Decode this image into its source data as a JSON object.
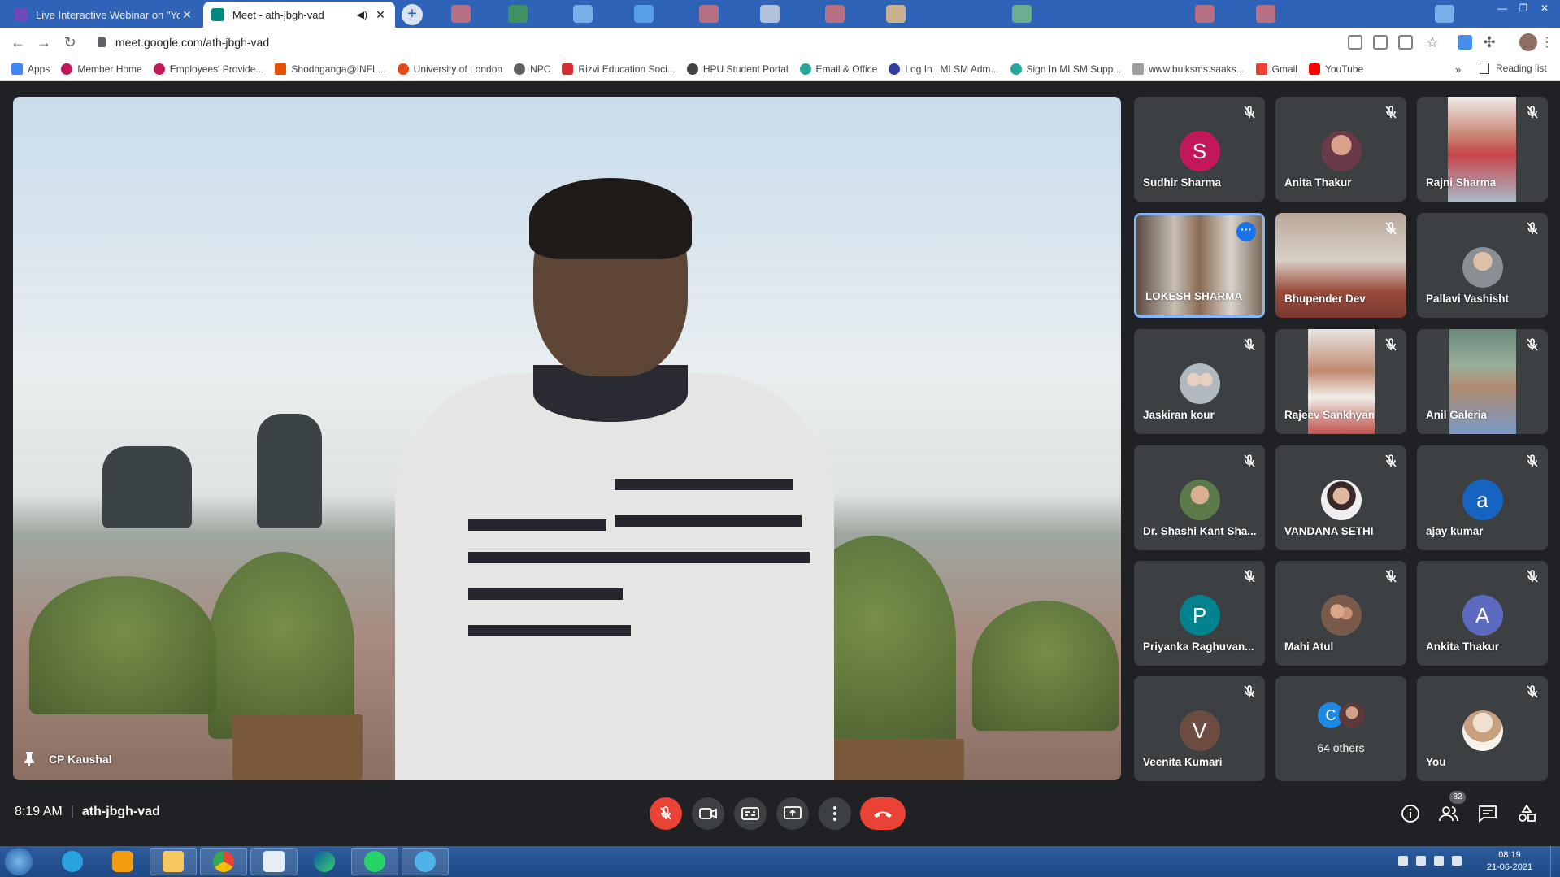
{
  "browser": {
    "tabs": [
      {
        "title": "Live Interactive Webinar on \"Yog",
        "favicon_color": "#7248b9"
      },
      {
        "title": "Meet - ath-jbgh-vad",
        "favicon_color": "#00897b"
      }
    ],
    "url": "meet.google.com/ath-jbgh-vad",
    "bookmarks": [
      {
        "label": "Apps",
        "color": "#4285f4"
      },
      {
        "label": "Member Home",
        "color": "#c2185b"
      },
      {
        "label": "Employees' Provide...",
        "color": "#c2185b"
      },
      {
        "label": "Shodhganga@INFL...",
        "color": "#e65100"
      },
      {
        "label": "University of London",
        "color": "#e64a19"
      },
      {
        "label": "NPC",
        "color": "#616161"
      },
      {
        "label": "Rizvi Education Soci...",
        "color": "#d32f2f"
      },
      {
        "label": "HPU Student Portal",
        "color": "#424242"
      },
      {
        "label": "Email & Office",
        "color": "#26a69a"
      },
      {
        "label": "Log In | MLSM Adm...",
        "color": "#303f9f"
      },
      {
        "label": "Sign In MLSM Supp...",
        "color": "#26a69a"
      },
      {
        "label": "www.bulksms.saaks...",
        "color": "#9e9e9e"
      },
      {
        "label": "Gmail",
        "color": "#ea4335"
      },
      {
        "label": "YouTube",
        "color": "#ff0000"
      }
    ],
    "bookmarks_more": "»",
    "reading_list": "Reading list"
  },
  "meet": {
    "main_speaker": "CP Kaushal",
    "participants": [
      {
        "name": "Sudhir Sharma",
        "initial": "S",
        "avatar_color": "#c2185b",
        "kind": "initial",
        "muted": true
      },
      {
        "name": "Anita Thakur",
        "initial": "",
        "avatar_color": "#6b3a4a",
        "kind": "photo",
        "muted": true
      },
      {
        "name": "Rajni Sharma",
        "initial": "",
        "avatar_color": "#c98a7a",
        "kind": "video",
        "muted": true
      },
      {
        "name": "LOKESH SHARMA",
        "initial": "",
        "avatar_color": "#7a6a5a",
        "kind": "video",
        "muted": false
      },
      {
        "name": "Bhupender Dev",
        "initial": "",
        "avatar_color": "#9a4a3a",
        "kind": "video",
        "muted": true
      },
      {
        "name": "Pallavi Vashisht",
        "initial": "",
        "avatar_color": "#8a8f95",
        "kind": "photo",
        "muted": true
      },
      {
        "name": "Jaskiran kour",
        "initial": "",
        "avatar_color": "#b0b8c0",
        "kind": "photo",
        "muted": true
      },
      {
        "name": "Rajeev Sankhyan",
        "initial": "",
        "avatar_color": "#c08a70",
        "kind": "video",
        "muted": true
      },
      {
        "name": "Anil Galeria",
        "initial": "",
        "avatar_color": "#6a8a7a",
        "kind": "video",
        "muted": true
      },
      {
        "name": "Dr. Shashi Kant Sha...",
        "initial": "",
        "avatar_color": "#5a7a4a",
        "kind": "photo",
        "muted": true
      },
      {
        "name": "VANDANA SETHI",
        "initial": "",
        "avatar_color": "#8a4a6a",
        "kind": "photo",
        "muted": true
      },
      {
        "name": "ajay kumar",
        "initial": "a",
        "avatar_color": "#1565c0",
        "kind": "initial",
        "muted": true
      },
      {
        "name": "Priyanka Raghuvan...",
        "initial": "P",
        "avatar_color": "#00838f",
        "kind": "initial",
        "muted": true
      },
      {
        "name": "Mahi Atul",
        "initial": "",
        "avatar_color": "#7a5a4a",
        "kind": "photo",
        "muted": true
      },
      {
        "name": "Ankita Thakur",
        "initial": "A",
        "avatar_color": "#5c6bc0",
        "kind": "initial",
        "muted": true
      },
      {
        "name": "Veenita Kumari",
        "initial": "V",
        "avatar_color": "#6d4c41",
        "kind": "initial",
        "muted": true
      },
      {
        "name": "64 others",
        "initial": "C",
        "avatar_color": "#1e88e5",
        "kind": "others",
        "muted": false
      },
      {
        "name": "You",
        "initial": "",
        "avatar_color": "#d4b89a",
        "kind": "photo",
        "muted": true
      }
    ],
    "time": "8:19 AM",
    "separator": "|",
    "meeting_code": "ath-jbgh-vad",
    "people_count": "82"
  },
  "taskbar": {
    "time": "08:19",
    "date": "21-06-2021"
  },
  "colors": {
    "meet_bg": "#202124",
    "tile_bg": "#3c4043",
    "end_call_red": "#ea4335",
    "highlight_border": "#8ab4f8"
  }
}
